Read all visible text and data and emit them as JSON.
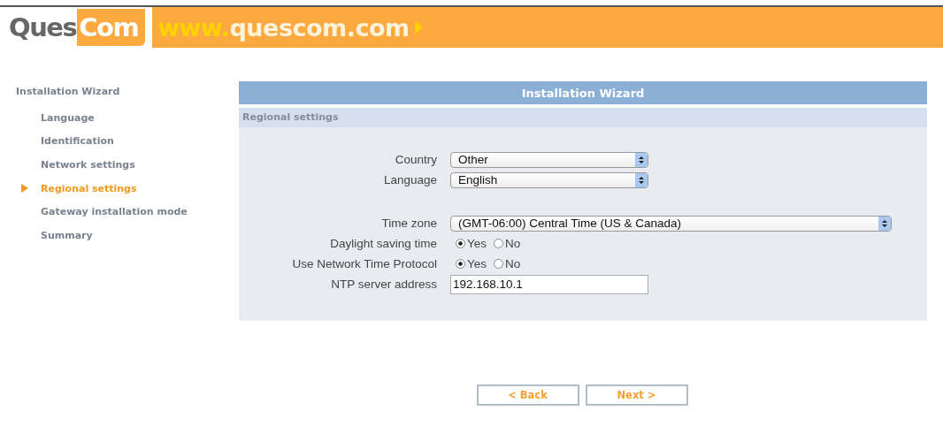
{
  "header": {
    "logo_dark": "Ques",
    "logo_light": "Com",
    "url_prefix": "www.",
    "url_rest": "quescom.com"
  },
  "sidebar": {
    "title": "Installation Wizard",
    "items": [
      {
        "label": "Language",
        "selected": false
      },
      {
        "label": "Identification",
        "selected": false
      },
      {
        "label": "Network settings",
        "selected": false
      },
      {
        "label": "Regional settings",
        "selected": true
      },
      {
        "label": "Gateway installation mode",
        "selected": false
      },
      {
        "label": "Summary",
        "selected": false
      }
    ]
  },
  "panel": {
    "title": "Installation Wizard",
    "section": "Regional settings",
    "groups": [
      [
        {
          "label": "Country",
          "kind": "select",
          "value": "Other",
          "wide": false
        },
        {
          "label": "Language",
          "kind": "select",
          "value": "English",
          "wide": false
        }
      ],
      [
        {
          "label": "Time zone",
          "kind": "select",
          "value": "(GMT-06:00) Central Time (US & Canada)",
          "wide": true
        },
        {
          "label": "Daylight saving time",
          "kind": "radio",
          "options": [
            {
              "label": "Yes",
              "selected": true
            },
            {
              "label": "No",
              "selected": false
            }
          ]
        },
        {
          "label": "Use Network Time Protocol",
          "kind": "radio",
          "options": [
            {
              "label": "Yes",
              "selected": true
            },
            {
              "label": "No",
              "selected": false
            }
          ]
        },
        {
          "label": "NTP server address",
          "kind": "text",
          "value": "192.168.10.1"
        }
      ]
    ]
  },
  "buttons": [
    {
      "label": "< Back"
    },
    {
      "label": "Next >"
    }
  ]
}
